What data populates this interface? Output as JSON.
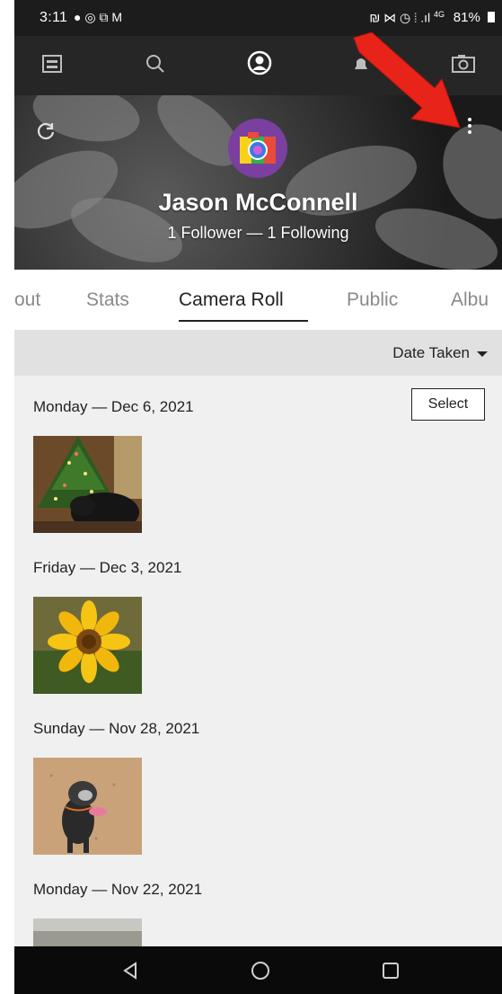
{
  "status_bar": {
    "time": "3:11",
    "left_icons": "● ◎ ⧉ M",
    "right_icons": "₪ ⋈ ◷ ⦙ .ıl",
    "network": "4G",
    "battery": "81%"
  },
  "top_nav": {
    "icons": [
      "feed-icon",
      "search-icon",
      "profile-icon",
      "notifications-icon",
      "camera-icon"
    ]
  },
  "profile": {
    "name": "Jason McConnell",
    "followers_line": "1 Follower — 1 Following"
  },
  "tabs": [
    {
      "label": "out"
    },
    {
      "label": "Stats"
    },
    {
      "label": "Camera Roll"
    },
    {
      "label": "Public"
    },
    {
      "label": "Albu"
    }
  ],
  "active_tab": "Camera Roll",
  "sort": {
    "label": "Date Taken"
  },
  "camera_roll": {
    "select_label": "Select",
    "groups": [
      {
        "title": "Monday — Dec 6, 2021"
      },
      {
        "title": "Friday — Dec 3, 2021"
      },
      {
        "title": "Sunday — Nov 28, 2021"
      },
      {
        "title": "Monday — Nov 22, 2021"
      }
    ]
  },
  "colors": {
    "annotation_arrow": "#e8231a",
    "avatar_background": "#7b3fa0"
  }
}
